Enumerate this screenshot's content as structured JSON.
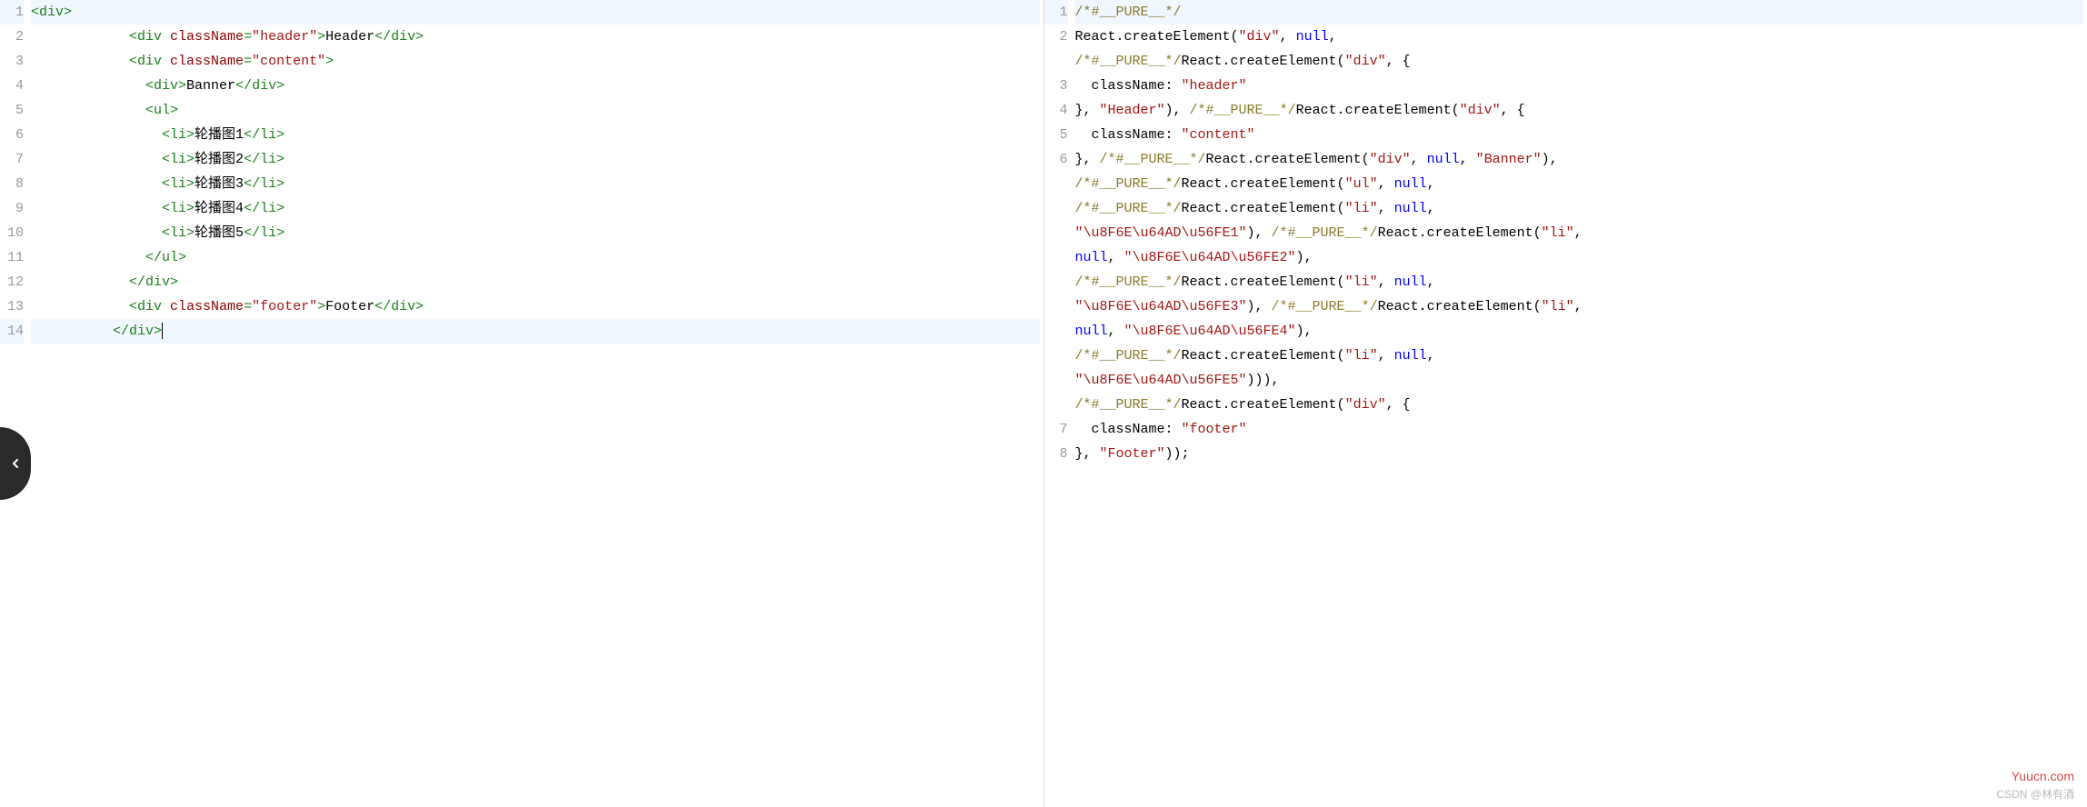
{
  "left": {
    "gutter": [
      "1",
      "2",
      "3",
      "4",
      "5",
      "6",
      "7",
      "8",
      "9",
      "10",
      "11",
      "12",
      "13",
      "14"
    ],
    "highlight_lines": [
      0,
      13
    ],
    "lines": [
      [
        {
          "c": "tag",
          "t": "<div>"
        }
      ],
      [
        {
          "c": "txt",
          "t": "            "
        },
        {
          "c": "tag",
          "t": "<div "
        },
        {
          "c": "attr",
          "t": "className"
        },
        {
          "c": "tag",
          "t": "="
        },
        {
          "c": "str",
          "t": "\"header\""
        },
        {
          "c": "tag",
          "t": ">"
        },
        {
          "c": "txt",
          "t": "Header"
        },
        {
          "c": "tag",
          "t": "</div>"
        }
      ],
      [
        {
          "c": "txt",
          "t": "            "
        },
        {
          "c": "tag",
          "t": "<div "
        },
        {
          "c": "attr",
          "t": "className"
        },
        {
          "c": "tag",
          "t": "="
        },
        {
          "c": "str",
          "t": "\"content\""
        },
        {
          "c": "tag",
          "t": ">"
        }
      ],
      [
        {
          "c": "txt",
          "t": "              "
        },
        {
          "c": "tag",
          "t": "<div>"
        },
        {
          "c": "txt",
          "t": "Banner"
        },
        {
          "c": "tag",
          "t": "</div>"
        }
      ],
      [
        {
          "c": "txt",
          "t": "              "
        },
        {
          "c": "tag",
          "t": "<ul>"
        }
      ],
      [
        {
          "c": "txt",
          "t": "                "
        },
        {
          "c": "tag",
          "t": "<li>"
        },
        {
          "c": "txt",
          "t": "轮播图1"
        },
        {
          "c": "tag",
          "t": "</li>"
        }
      ],
      [
        {
          "c": "txt",
          "t": "                "
        },
        {
          "c": "tag",
          "t": "<li>"
        },
        {
          "c": "txt",
          "t": "轮播图2"
        },
        {
          "c": "tag",
          "t": "</li>"
        }
      ],
      [
        {
          "c": "txt",
          "t": "                "
        },
        {
          "c": "tag",
          "t": "<li>"
        },
        {
          "c": "txt",
          "t": "轮播图3"
        },
        {
          "c": "tag",
          "t": "</li>"
        }
      ],
      [
        {
          "c": "txt",
          "t": "                "
        },
        {
          "c": "tag",
          "t": "<li>"
        },
        {
          "c": "txt",
          "t": "轮播图4"
        },
        {
          "c": "tag",
          "t": "</li>"
        }
      ],
      [
        {
          "c": "txt",
          "t": "                "
        },
        {
          "c": "tag",
          "t": "<li>"
        },
        {
          "c": "txt",
          "t": "轮播图5"
        },
        {
          "c": "tag",
          "t": "</li>"
        }
      ],
      [
        {
          "c": "txt",
          "t": "              "
        },
        {
          "c": "tag",
          "t": "</ul>"
        }
      ],
      [
        {
          "c": "txt",
          "t": "            "
        },
        {
          "c": "tag",
          "t": "</div>"
        }
      ],
      [
        {
          "c": "txt",
          "t": "            "
        },
        {
          "c": "tag",
          "t": "<div "
        },
        {
          "c": "attr",
          "t": "className"
        },
        {
          "c": "tag",
          "t": "="
        },
        {
          "c": "str",
          "t": "\"footer\""
        },
        {
          "c": "tag",
          "t": ">"
        },
        {
          "c": "txt",
          "t": "Footer"
        },
        {
          "c": "tag",
          "t": "</div>"
        }
      ],
      [
        {
          "c": "txt",
          "t": "          "
        },
        {
          "c": "tag",
          "t": "</div>"
        },
        {
          "c": "cursor",
          "t": ""
        }
      ]
    ]
  },
  "right": {
    "gutter": [
      "1",
      "2",
      "",
      "3",
      "4",
      "5",
      "6",
      "",
      "",
      "",
      "",
      "",
      "",
      "",
      "",
      "",
      "",
      "7",
      "8"
    ],
    "highlight_lines": [
      0
    ],
    "lines": [
      [
        {
          "c": "cmt",
          "t": "/*#__PURE__*/"
        }
      ],
      [
        {
          "c": "id",
          "t": "React.createElement("
        },
        {
          "c": "str",
          "t": "\"div\""
        },
        {
          "c": "id",
          "t": ", "
        },
        {
          "c": "kw",
          "t": "null"
        },
        {
          "c": "id",
          "t": ", "
        }
      ],
      [
        {
          "c": "cmt",
          "t": "/*#__PURE__*/"
        },
        {
          "c": "id",
          "t": "React.createElement("
        },
        {
          "c": "str",
          "t": "\"div\""
        },
        {
          "c": "id",
          "t": ", {"
        }
      ],
      [
        {
          "c": "id",
          "t": "  className: "
        },
        {
          "c": "str",
          "t": "\"header\""
        }
      ],
      [
        {
          "c": "id",
          "t": "}, "
        },
        {
          "c": "str",
          "t": "\"Header\""
        },
        {
          "c": "id",
          "t": "), "
        },
        {
          "c": "cmt",
          "t": "/*#__PURE__*/"
        },
        {
          "c": "id",
          "t": "React.createElement("
        },
        {
          "c": "str",
          "t": "\"div\""
        },
        {
          "c": "id",
          "t": ", {"
        }
      ],
      [
        {
          "c": "id",
          "t": "  className: "
        },
        {
          "c": "str",
          "t": "\"content\""
        }
      ],
      [
        {
          "c": "id",
          "t": "}, "
        },
        {
          "c": "cmt",
          "t": "/*#__PURE__*/"
        },
        {
          "c": "id",
          "t": "React.createElement("
        },
        {
          "c": "str",
          "t": "\"div\""
        },
        {
          "c": "id",
          "t": ", "
        },
        {
          "c": "kw",
          "t": "null"
        },
        {
          "c": "id",
          "t": ", "
        },
        {
          "c": "str",
          "t": "\"Banner\""
        },
        {
          "c": "id",
          "t": "), "
        }
      ],
      [
        {
          "c": "cmt",
          "t": "/*#__PURE__*/"
        },
        {
          "c": "id",
          "t": "React.createElement("
        },
        {
          "c": "str",
          "t": "\"ul\""
        },
        {
          "c": "id",
          "t": ", "
        },
        {
          "c": "kw",
          "t": "null"
        },
        {
          "c": "id",
          "t": ", "
        }
      ],
      [
        {
          "c": "cmt",
          "t": "/*#__PURE__*/"
        },
        {
          "c": "id",
          "t": "React.createElement("
        },
        {
          "c": "str",
          "t": "\"li\""
        },
        {
          "c": "id",
          "t": ", "
        },
        {
          "c": "kw",
          "t": "null"
        },
        {
          "c": "id",
          "t": ", "
        }
      ],
      [
        {
          "c": "str",
          "t": "\"\\u8F6E\\u64AD\\u56FE1\""
        },
        {
          "c": "id",
          "t": "), "
        },
        {
          "c": "cmt",
          "t": "/*#__PURE__*/"
        },
        {
          "c": "id",
          "t": "React.createElement("
        },
        {
          "c": "str",
          "t": "\"li\""
        },
        {
          "c": "id",
          "t": ", "
        }
      ],
      [
        {
          "c": "kw",
          "t": "null"
        },
        {
          "c": "id",
          "t": ", "
        },
        {
          "c": "str",
          "t": "\"\\u8F6E\\u64AD\\u56FE2\""
        },
        {
          "c": "id",
          "t": "), "
        }
      ],
      [
        {
          "c": "cmt",
          "t": "/*#__PURE__*/"
        },
        {
          "c": "id",
          "t": "React.createElement("
        },
        {
          "c": "str",
          "t": "\"li\""
        },
        {
          "c": "id",
          "t": ", "
        },
        {
          "c": "kw",
          "t": "null"
        },
        {
          "c": "id",
          "t": ", "
        }
      ],
      [
        {
          "c": "str",
          "t": "\"\\u8F6E\\u64AD\\u56FE3\""
        },
        {
          "c": "id",
          "t": "), "
        },
        {
          "c": "cmt",
          "t": "/*#__PURE__*/"
        },
        {
          "c": "id",
          "t": "React.createElement("
        },
        {
          "c": "str",
          "t": "\"li\""
        },
        {
          "c": "id",
          "t": ", "
        }
      ],
      [
        {
          "c": "kw",
          "t": "null"
        },
        {
          "c": "id",
          "t": ", "
        },
        {
          "c": "str",
          "t": "\"\\u8F6E\\u64AD\\u56FE4\""
        },
        {
          "c": "id",
          "t": "), "
        }
      ],
      [
        {
          "c": "cmt",
          "t": "/*#__PURE__*/"
        },
        {
          "c": "id",
          "t": "React.createElement("
        },
        {
          "c": "str",
          "t": "\"li\""
        },
        {
          "c": "id",
          "t": ", "
        },
        {
          "c": "kw",
          "t": "null"
        },
        {
          "c": "id",
          "t": ", "
        }
      ],
      [
        {
          "c": "str",
          "t": "\"\\u8F6E\\u64AD\\u56FE5\""
        },
        {
          "c": "id",
          "t": "))), "
        }
      ],
      [
        {
          "c": "cmt",
          "t": "/*#__PURE__*/"
        },
        {
          "c": "id",
          "t": "React.createElement("
        },
        {
          "c": "str",
          "t": "\"div\""
        },
        {
          "c": "id",
          "t": ", {"
        }
      ],
      [
        {
          "c": "id",
          "t": "  className: "
        },
        {
          "c": "str",
          "t": "\"footer\""
        }
      ],
      [
        {
          "c": "id",
          "t": "}, "
        },
        {
          "c": "str",
          "t": "\"Footer\""
        },
        {
          "c": "id",
          "t": "));"
        }
      ]
    ]
  },
  "watermarks": {
    "w1": "Yuucn.com",
    "w2": "CSDN @林有酒"
  }
}
